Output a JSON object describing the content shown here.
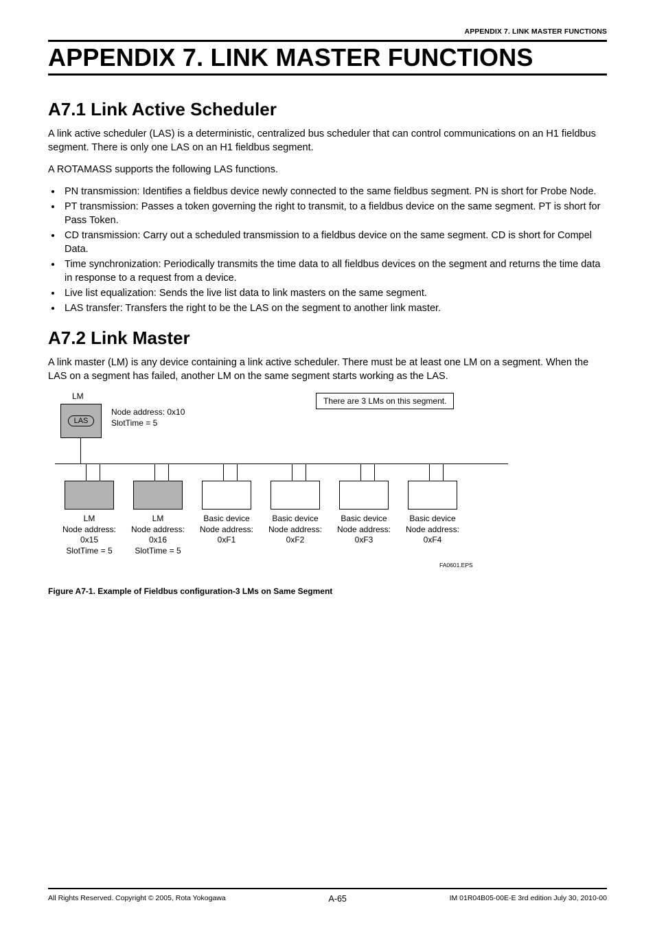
{
  "running_head": "APPENDIX 7.  LINK MASTER FUNCTIONS",
  "appendix_title": "APPENDIX 7.  LINK MASTER FUNCTIONS",
  "sections": {
    "a71": {
      "heading": "A7.1  Link Active Scheduler",
      "para1": "A link active scheduler (LAS) is a deterministic, centralized bus scheduler that can control communications on an H1 fieldbus segment.  There is only one LAS on an H1 fieldbus segment.",
      "para2": "A ROTAMASS supports the following LAS functions.",
      "bullets": [
        "PN transmission: Identifies a fieldbus device newly connected to the same fieldbus segment.  PN is short for Probe Node.",
        "PT transmission: Passes a token governing the right to transmit, to a fieldbus device on the same segment.  PT is short for Pass Token.",
        "CD transmission: Carry out a scheduled transmission to a fieldbus device on the same segment.  CD is short for Compel Data.",
        "Time synchronization: Periodically transmits the time data to all fieldbus devices on the segment and returns the time data in response to a request from a device.",
        "Live list equalization: Sends the live list data to link masters on the same segment.",
        "LAS transfer: Transfers the right to be the LAS on the segment to another link master."
      ]
    },
    "a72": {
      "heading": "A7.2  Link Master",
      "para1": "A link master (LM) is any device containing a link active scheduler.  There must be at least one LM on a segment.  When the LAS on a segment has failed, another LM on the same segment starts working as the LAS."
    }
  },
  "figure": {
    "lm_label": "LM",
    "las_label": "LAS",
    "slot_addr_line1": "Node address: 0x10",
    "slot_addr_line2": "SlotTime = 5",
    "annotation": "There are 3 LMs on this segment.",
    "devices": [
      {
        "line1": "LM",
        "line2": "Node address:",
        "line3": "0x15",
        "line4": "SlotTime = 5"
      },
      {
        "line1": "LM",
        "line2": "Node address:",
        "line3": "0x16",
        "line4": "SlotTime = 5"
      },
      {
        "line1": "Basic device",
        "line2": "Node address:",
        "line3": "0xF1",
        "line4": ""
      },
      {
        "line1": "Basic device",
        "line2": "Node address:",
        "line3": "0xF2",
        "line4": ""
      },
      {
        "line1": "Basic device",
        "line2": "Node address:",
        "line3": "0xF3",
        "line4": ""
      },
      {
        "line1": "Basic device",
        "line2": "Node address:",
        "line3": "0xF4",
        "line4": ""
      }
    ],
    "eps": "FA0601.EPS",
    "caption": "Figure A7-1.  Example of Fieldbus configuration-3 LMs on Same Segment"
  },
  "footer": {
    "left": "All Rights Reserved. Copyright © 2005, Rota Yokogawa",
    "center": "A-65",
    "right": "IM 01R04B05-00E-E    3rd edition July 30, 2010-00"
  }
}
